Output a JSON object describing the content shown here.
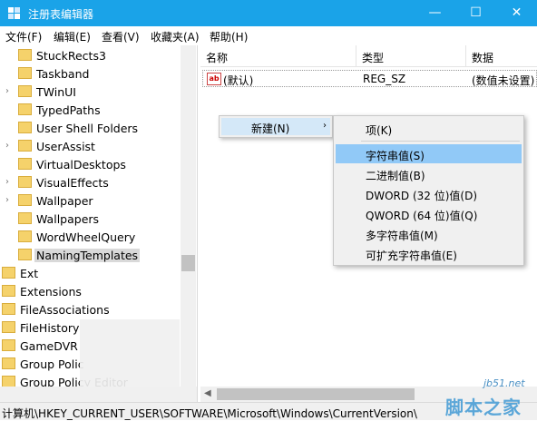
{
  "window": {
    "title": "注册表编辑器",
    "min": "—",
    "max": "☐",
    "close": "✕"
  },
  "menu": [
    "文件(F)",
    "编辑(E)",
    "查看(V)",
    "收藏夹(A)",
    "帮助(H)"
  ],
  "tree": {
    "items": [
      {
        "label": "StuckRects3",
        "expandable": false,
        "indent": 1
      },
      {
        "label": "Taskband",
        "expandable": false,
        "indent": 1
      },
      {
        "label": "TWinUI",
        "expandable": true,
        "indent": 1
      },
      {
        "label": "TypedPaths",
        "expandable": false,
        "indent": 1
      },
      {
        "label": "User Shell Folders",
        "expandable": false,
        "indent": 1
      },
      {
        "label": "UserAssist",
        "expandable": true,
        "indent": 1
      },
      {
        "label": "VirtualDesktops",
        "expandable": false,
        "indent": 1
      },
      {
        "label": "VisualEffects",
        "expandable": true,
        "indent": 1
      },
      {
        "label": "Wallpaper",
        "expandable": true,
        "indent": 1
      },
      {
        "label": "Wallpapers",
        "expandable": false,
        "indent": 1
      },
      {
        "label": "WordWheelQuery",
        "expandable": false,
        "indent": 1
      },
      {
        "label": "NamingTemplates",
        "expandable": false,
        "indent": 1,
        "selected": true
      },
      {
        "label": "Ext",
        "expandable": false,
        "indent": 0
      },
      {
        "label": "Extensions",
        "expandable": false,
        "indent": 0
      },
      {
        "label": "FileAssociations",
        "expandable": false,
        "indent": 0
      },
      {
        "label": "FileHistory",
        "expandable": false,
        "indent": 0
      },
      {
        "label": "GameDVR",
        "expandable": false,
        "indent": 0
      },
      {
        "label": "Group Polic",
        "expandable": false,
        "indent": 0
      },
      {
        "label": "Group Policy Editor",
        "expandable": false,
        "indent": 0
      }
    ]
  },
  "list": {
    "columns": {
      "name": "名称",
      "type": "类型",
      "data": "数据"
    },
    "rows": [
      {
        "icon": "ab",
        "name": "(默认)",
        "type": "REG_SZ",
        "data": "(数值未设置)"
      }
    ]
  },
  "context_menu": {
    "new_label": "新建(N)",
    "arrow": "›",
    "submenu": [
      "项(K)",
      "字符串值(S)",
      "二进制值(B)",
      "DWORD (32 位)值(D)",
      "QWORD (64 位)值(Q)",
      "多字符串值(M)",
      "可扩充字符串值(E)"
    ]
  },
  "status": {
    "path": "计算机\\HKEY_CURRENT_USER\\SOFTWARE\\Microsoft\\Windows\\CurrentVersion\\"
  },
  "watermark": {
    "site": "jb51.net",
    "name": "脚本之家"
  },
  "colors": {
    "titlebar": "#1aa3e8",
    "highlight": "#91c9f7",
    "folder": "#f5d26b"
  }
}
